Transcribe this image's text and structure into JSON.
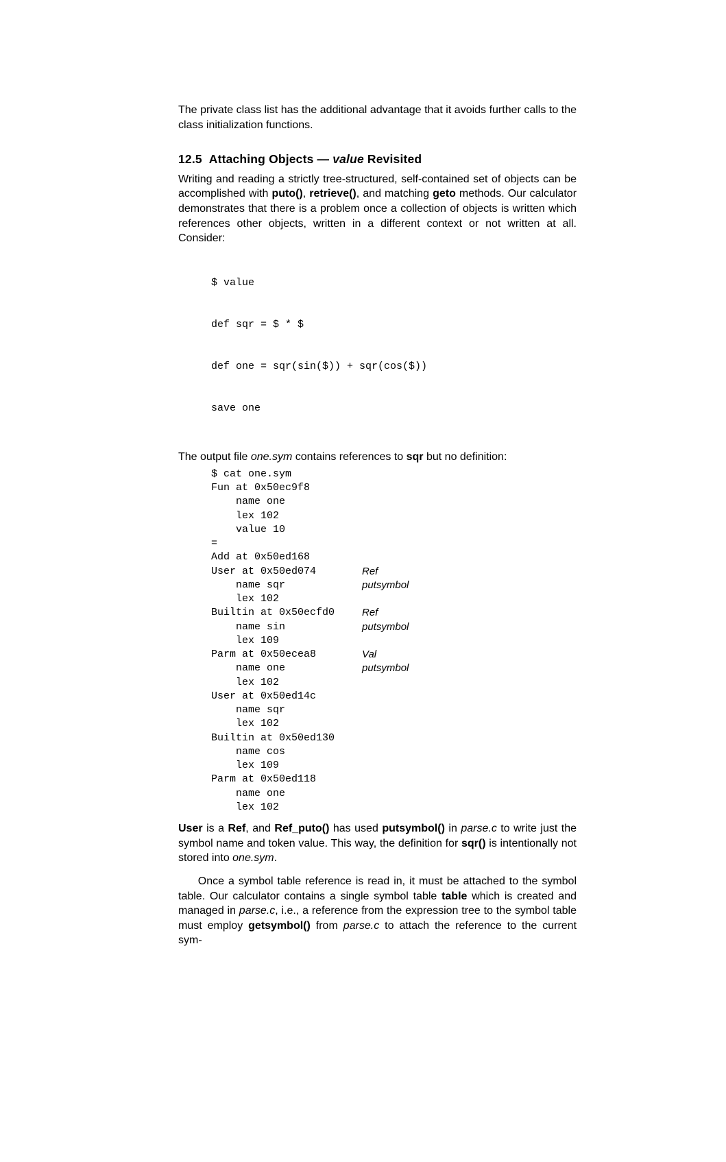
{
  "intro_para": "The private class list has the additional advantage that it avoids further calls to the class initialization functions.",
  "section": {
    "number": "12.5",
    "title_pre": "Attaching Objects — ",
    "title_italic": "value",
    "title_post": " Revisited"
  },
  "para1": {
    "pre": "Writing and reading a strictly tree-structured, self-contained set of objects can be accomplished with ",
    "b1": "puto()",
    "t1": ", ",
    "b2": "retrieve()",
    "t2": ", and matching ",
    "b3": "geto",
    "t3": " methods. Our calculator demonstrates that there is a problem once a collection of objects is written which references other objects, written in a different context or not written at all. Consider:"
  },
  "code1": [
    "$ value",
    "def sqr = $ * $",
    "def one = sqr(sin($)) + sqr(cos($))",
    "save one"
  ],
  "para2": {
    "t0": "The output file ",
    "i1": "one.sym",
    "t1": " contains references to ",
    "b1": "sqr",
    "t2": " but no definition:"
  },
  "code2": [
    {
      "l": "$ cat one.sym",
      "r": ""
    },
    {
      "l": "Fun at 0x50ec9f8",
      "r": ""
    },
    {
      "l": "    name one",
      "r": ""
    },
    {
      "l": "    lex 102",
      "r": ""
    },
    {
      "l": "    value 10",
      "r": ""
    },
    {
      "l": "=",
      "r": ""
    },
    {
      "l": "Add at 0x50ed168",
      "r": ""
    },
    {
      "l": "User at 0x50ed074",
      "r": "Ref"
    },
    {
      "l": "    name sqr",
      "r": "putsymbol"
    },
    {
      "l": "    lex 102",
      "r": ""
    },
    {
      "l": "Builtin at 0x50ecfd0",
      "r": "Ref"
    },
    {
      "l": "    name sin",
      "r": "putsymbol"
    },
    {
      "l": "    lex 109",
      "r": ""
    },
    {
      "l": "Parm at 0x50ecea8",
      "r": "Val"
    },
    {
      "l": "    name one",
      "r": "putsymbol"
    },
    {
      "l": "    lex 102",
      "r": ""
    },
    {
      "l": "User at 0x50ed14c",
      "r": ""
    },
    {
      "l": "    name sqr",
      "r": ""
    },
    {
      "l": "    lex 102",
      "r": ""
    },
    {
      "l": "Builtin at 0x50ed130",
      "r": ""
    },
    {
      "l": "    name cos",
      "r": ""
    },
    {
      "l": "    lex 109",
      "r": ""
    },
    {
      "l": "Parm at 0x50ed118",
      "r": ""
    },
    {
      "l": "    name one",
      "r": ""
    },
    {
      "l": "    lex 102",
      "r": ""
    }
  ],
  "para3": {
    "b0": "User",
    "t0": " is a ",
    "b1": "Ref",
    "t1": ", and ",
    "b2": "Ref_puto()",
    "t2": " has used ",
    "b3": "putsymbol()",
    "t3": " in ",
    "i1": "parse.c",
    "t4": " to write just the symbol name and token value. This way, the definition for ",
    "b4": "sqr()",
    "t5": " is intentionally not stored into ",
    "i2": "one.sym",
    "t6": "."
  },
  "para4": {
    "t0": "Once a symbol table reference is read in, it must be attached to the symbol table. Our calculator contains a single symbol table ",
    "b1": "table",
    "t1": " which is created and managed in ",
    "i1": "parse.c",
    "t2": ", i.e., a reference from the expression tree to the symbol table must employ ",
    "b2": "getsymbol()",
    "t3": " from ",
    "i2": "parse.c",
    "t4": " to attach the reference to the current sym-"
  }
}
